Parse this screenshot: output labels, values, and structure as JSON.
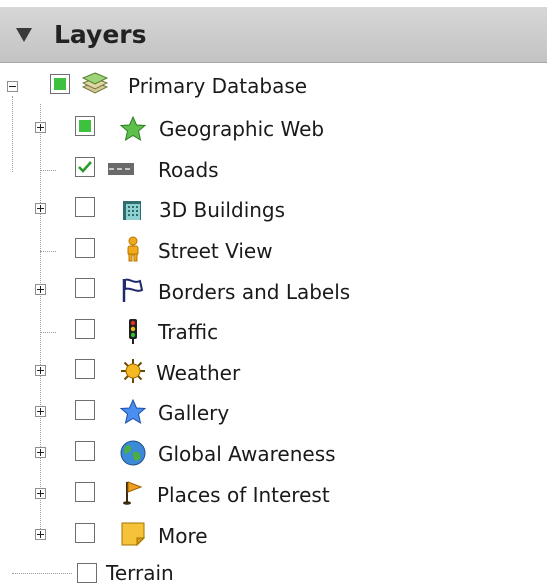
{
  "panel": {
    "title": "Layers"
  },
  "root": {
    "label": "Primary Database",
    "icon": "layers-stack-icon"
  },
  "layers": [
    {
      "label": "Geographic Web",
      "icon": "green-star-icon"
    },
    {
      "label": "Roads",
      "icon": "road-icon"
    },
    {
      "label": "3D Buildings",
      "icon": "buildings-icon"
    },
    {
      "label": "Street View",
      "icon": "pegman-icon"
    },
    {
      "label": "Borders and Labels",
      "icon": "flag-icon"
    },
    {
      "label": "Traffic",
      "icon": "traffic-light-icon"
    },
    {
      "label": "Weather",
      "icon": "sun-icon"
    },
    {
      "label": "Gallery",
      "icon": "blue-star-icon"
    },
    {
      "label": "Global Awareness",
      "icon": "globe-icon"
    },
    {
      "label": "Places of Interest",
      "icon": "poi-flag-icon"
    },
    {
      "label": "More",
      "icon": "sticky-note-icon"
    }
  ],
  "terrain": {
    "label": "Terrain"
  }
}
